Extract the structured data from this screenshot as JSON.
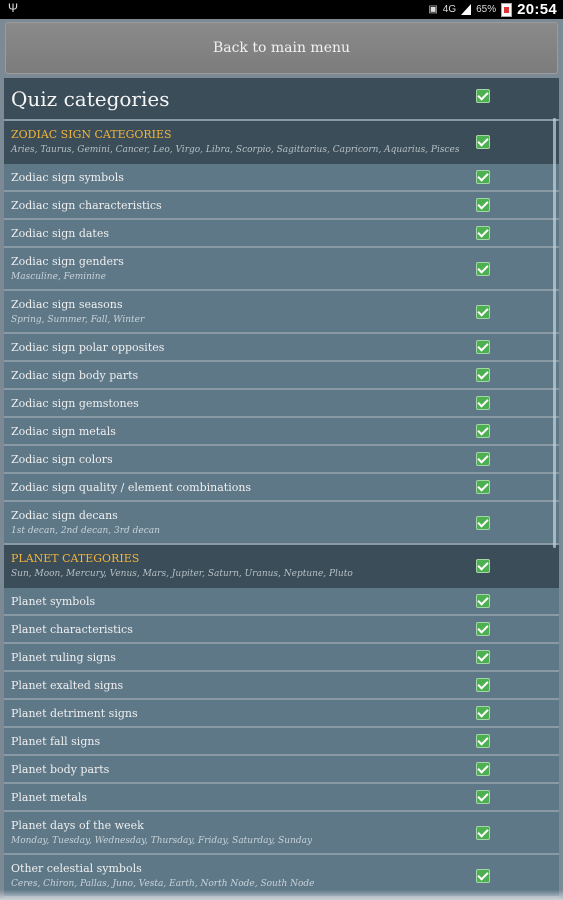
{
  "status": {
    "network": "4G",
    "battery": "65%",
    "time": "20:54"
  },
  "back_button": {
    "label": "Back to main menu"
  },
  "title": "Quiz categories",
  "rows": [
    {
      "type": "header",
      "label": "ZODIAC SIGN CATEGORIES",
      "sub": "Aries, Taurus, Gemini, Cancer, Leo, Virgo, Libra, Scorpio, Sagittarius, Capricorn, Aquarius, Pisces",
      "checked": true
    },
    {
      "type": "item",
      "label": "Zodiac sign symbols",
      "checked": true
    },
    {
      "type": "item",
      "label": "Zodiac sign characteristics",
      "checked": true
    },
    {
      "type": "item",
      "label": "Zodiac sign dates",
      "checked": true
    },
    {
      "type": "item",
      "label": "Zodiac sign genders",
      "sub": "Masculine, Feminine",
      "checked": true
    },
    {
      "type": "item",
      "label": "Zodiac sign seasons",
      "sub": "Spring, Summer, Fall, Winter",
      "checked": true
    },
    {
      "type": "item",
      "label": "Zodiac sign polar opposites",
      "checked": true
    },
    {
      "type": "item",
      "label": "Zodiac sign body parts",
      "checked": true
    },
    {
      "type": "item",
      "label": "Zodiac sign gemstones",
      "checked": true
    },
    {
      "type": "item",
      "label": "Zodiac sign metals",
      "checked": true
    },
    {
      "type": "item",
      "label": "Zodiac sign colors",
      "checked": true
    },
    {
      "type": "item",
      "label": "Zodiac sign quality / element combinations",
      "checked": true
    },
    {
      "type": "item",
      "label": "Zodiac sign decans",
      "sub": "1st decan, 2nd decan, 3rd decan",
      "checked": true
    },
    {
      "type": "header",
      "label": "PLANET CATEGORIES",
      "sub": "Sun, Moon, Mercury, Venus, Mars, Jupiter, Saturn, Uranus, Neptune, Pluto",
      "checked": true
    },
    {
      "type": "item",
      "label": "Planet symbols",
      "checked": true
    },
    {
      "type": "item",
      "label": "Planet characteristics",
      "checked": true
    },
    {
      "type": "item",
      "label": "Planet ruling signs",
      "checked": true
    },
    {
      "type": "item",
      "label": "Planet exalted signs",
      "checked": true
    },
    {
      "type": "item",
      "label": "Planet detriment signs",
      "checked": true
    },
    {
      "type": "item",
      "label": "Planet fall signs",
      "checked": true
    },
    {
      "type": "item",
      "label": "Planet body parts",
      "checked": true
    },
    {
      "type": "item",
      "label": "Planet metals",
      "checked": true
    },
    {
      "type": "item",
      "label": "Planet days of the week",
      "sub": "Monday, Tuesday, Wednesday, Thursday, Friday, Saturday, Sunday",
      "checked": true
    },
    {
      "type": "item",
      "label": "Other celestial symbols",
      "sub": "Ceres, Chiron, Pallas, Juno, Vesta, Earth, North Node, South Node",
      "checked": true
    }
  ]
}
